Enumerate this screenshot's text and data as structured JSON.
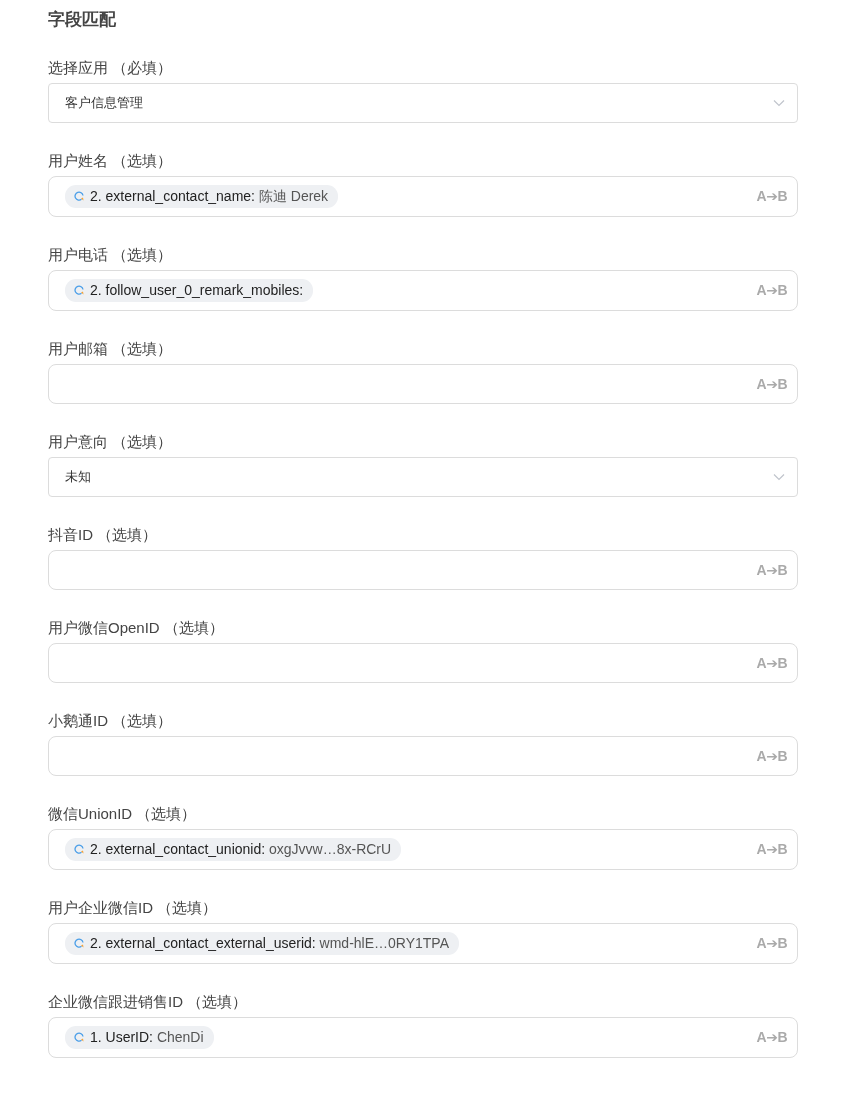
{
  "title": "字段匹配",
  "fields": [
    {
      "label": "选择应用",
      "hint": "（必填）",
      "kind": "select",
      "value": "客户信息管理"
    },
    {
      "label": "用户姓名",
      "hint": "（选填）",
      "kind": "mapped",
      "action": "A➔B",
      "token": {
        "key": "2. external_contact_name:",
        "value": "陈迪 Derek"
      }
    },
    {
      "label": "用户电话",
      "hint": "（选填）",
      "kind": "mapped",
      "action": "A➔B",
      "token": {
        "key": "2. follow_user_0_remark_mobiles:"
      }
    },
    {
      "label": "用户邮箱",
      "hint": "（选填）",
      "kind": "mapped",
      "action": "A➔B"
    },
    {
      "label": "用户意向",
      "hint": "（选填）",
      "kind": "select",
      "value": "未知"
    },
    {
      "label": "抖音ID",
      "hint": "（选填）",
      "kind": "mapped",
      "action": "A➔B"
    },
    {
      "label": "用户微信OpenID",
      "hint": "（选填）",
      "kind": "mapped",
      "action": "A➔B"
    },
    {
      "label": "小鹅通ID",
      "hint": "（选填）",
      "kind": "mapped",
      "action": "A➔B"
    },
    {
      "label": "微信UnionID",
      "hint": "（选填）",
      "kind": "mapped",
      "action": "A➔B",
      "token": {
        "key": "2. external_contact_unionid:",
        "value": "oxgJvvw…8x-RCrU"
      }
    },
    {
      "label": "用户企业微信ID",
      "hint": "（选填）",
      "kind": "mapped",
      "action": "A➔B",
      "token": {
        "key": "2. external_contact_external_userid:",
        "value": "wmd-hlE…0RY1TPA"
      }
    },
    {
      "label": "企业微信跟进销售ID",
      "hint": "（选填）",
      "kind": "mapped",
      "action": "A➔B",
      "token": {
        "key": "1. UserID:",
        "value": "ChenDi"
      }
    }
  ]
}
